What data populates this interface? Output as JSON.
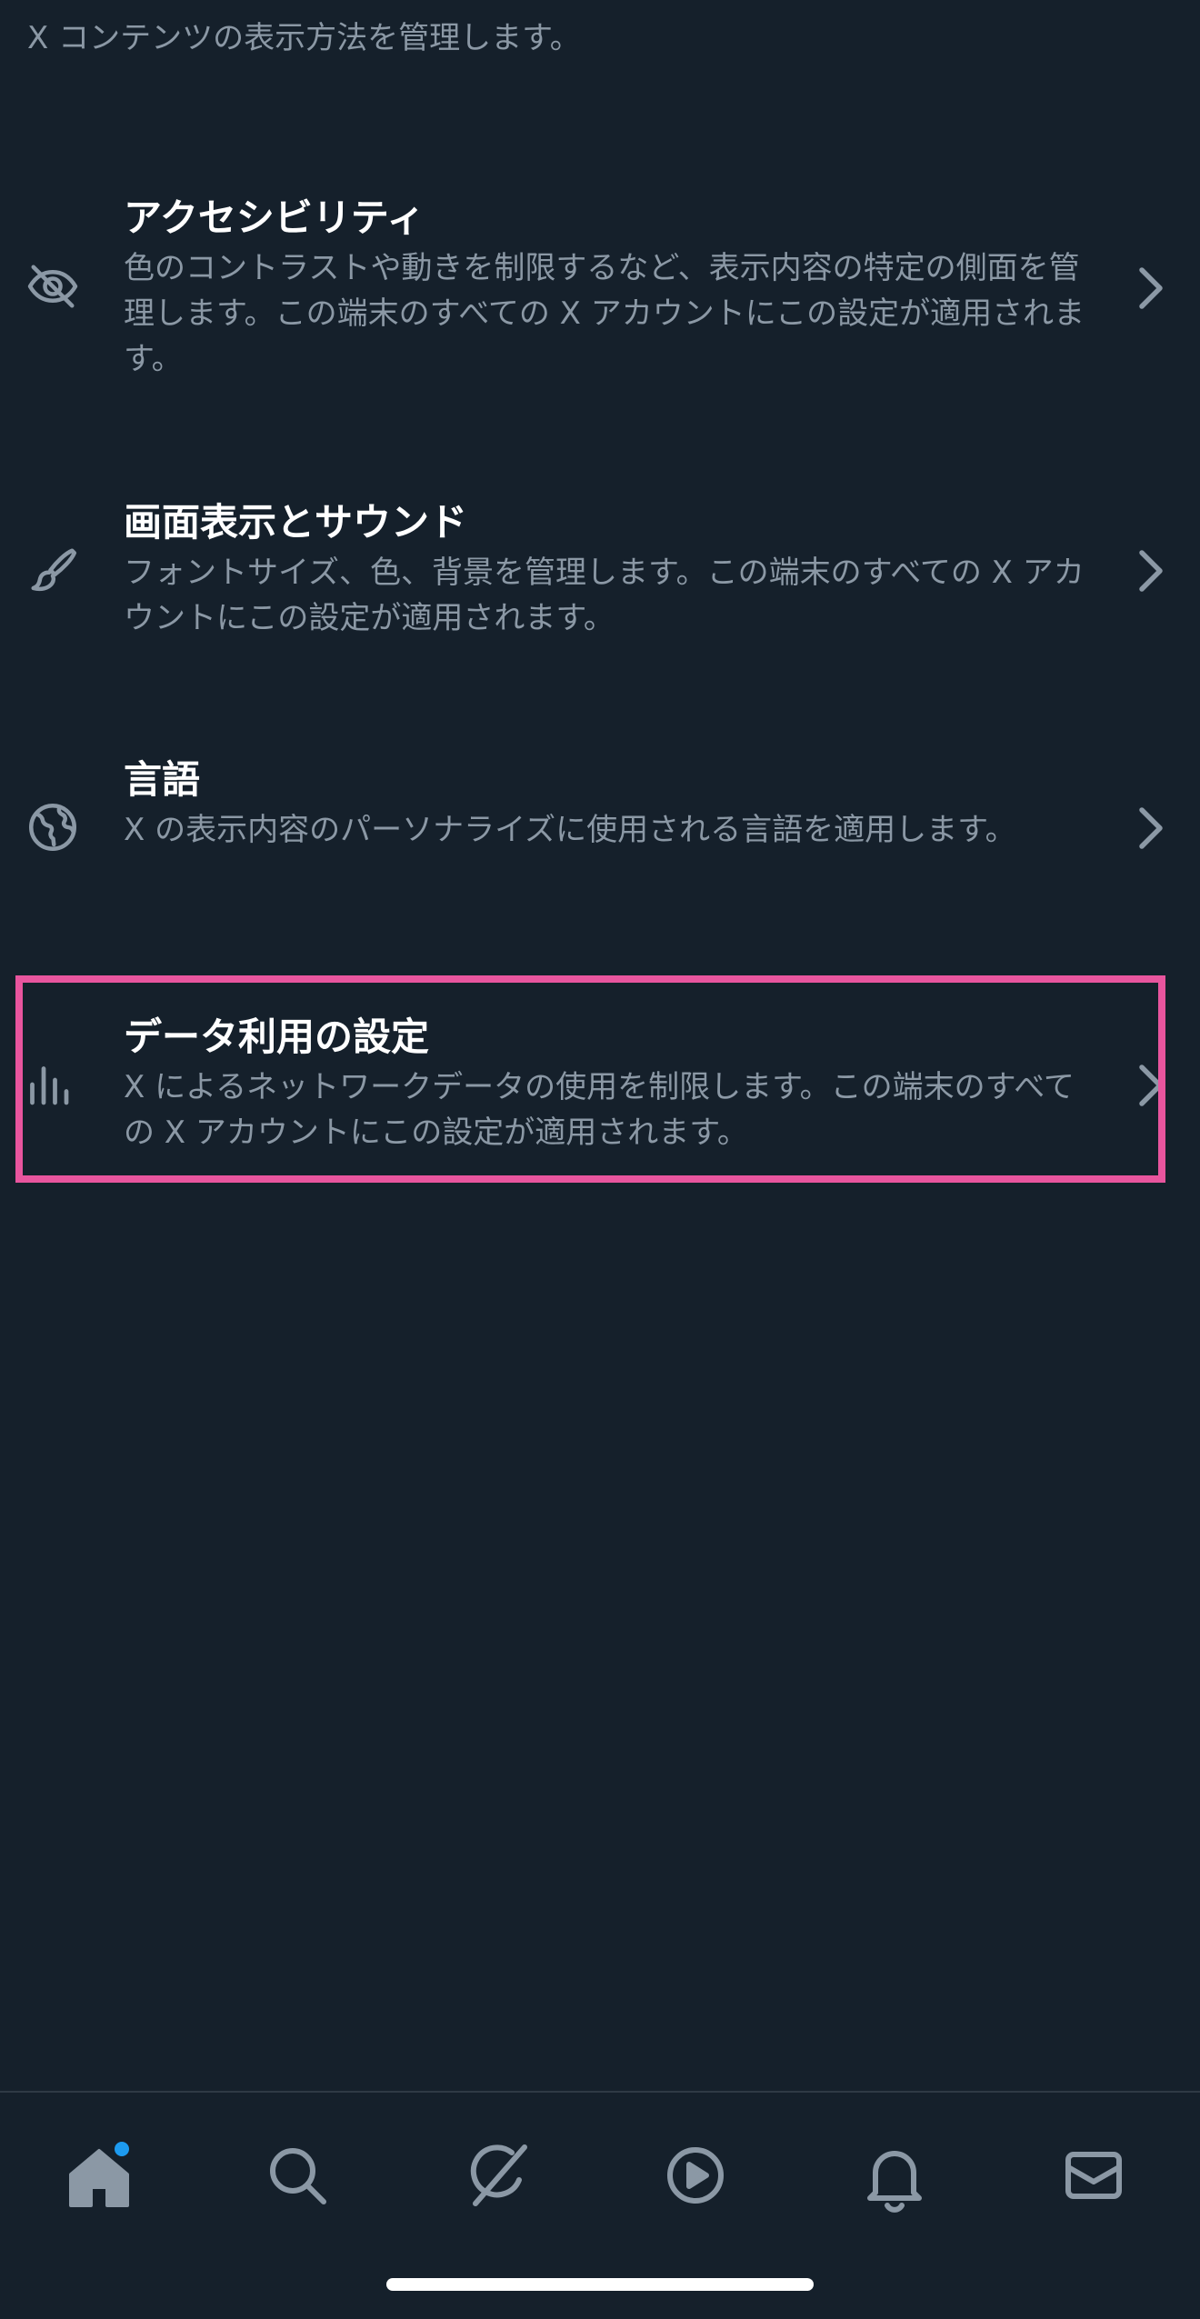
{
  "header": {
    "description": "X コンテンツの表示方法を管理します。"
  },
  "settings": {
    "items": [
      {
        "title": "アクセシビリティ",
        "description": "色のコントラストや動きを制限するなど、表示内容の特定の側面を管理します。この端末のすべての X アカウントにこの設定が適用されます。",
        "icon": "eye-slash-icon"
      },
      {
        "title": "画面表示とサウンド",
        "description": "フォントサイズ、色、背景を管理します。この端末のすべての X アカウントにこの設定が適用されます。",
        "icon": "paintbrush-icon"
      },
      {
        "title": "言語",
        "description": "X の表示内容のパーソナライズに使用される言語を適用します。",
        "icon": "globe-icon"
      },
      {
        "title": "データ利用の設定",
        "description": "X によるネットワークデータの使用を制限します。この端末のすべての X アカウントにこの設定が適用されます。",
        "icon": "bar-chart-icon",
        "highlighted": true
      }
    ]
  },
  "tab_bar": {
    "tabs": [
      {
        "icon": "home-icon",
        "selected": true,
        "has_notification_dot": true
      },
      {
        "icon": "search-icon"
      },
      {
        "icon": "grok-icon"
      },
      {
        "icon": "video-play-icon"
      },
      {
        "icon": "bell-icon"
      },
      {
        "icon": "mail-icon"
      }
    ]
  },
  "colors": {
    "background": "#15202b",
    "primary_text": "#ffffff",
    "secondary_text": "#8b98a5",
    "highlight_border": "#e8559e",
    "notification_dot": "#1d9bf0",
    "icon": "#8b98a5"
  }
}
